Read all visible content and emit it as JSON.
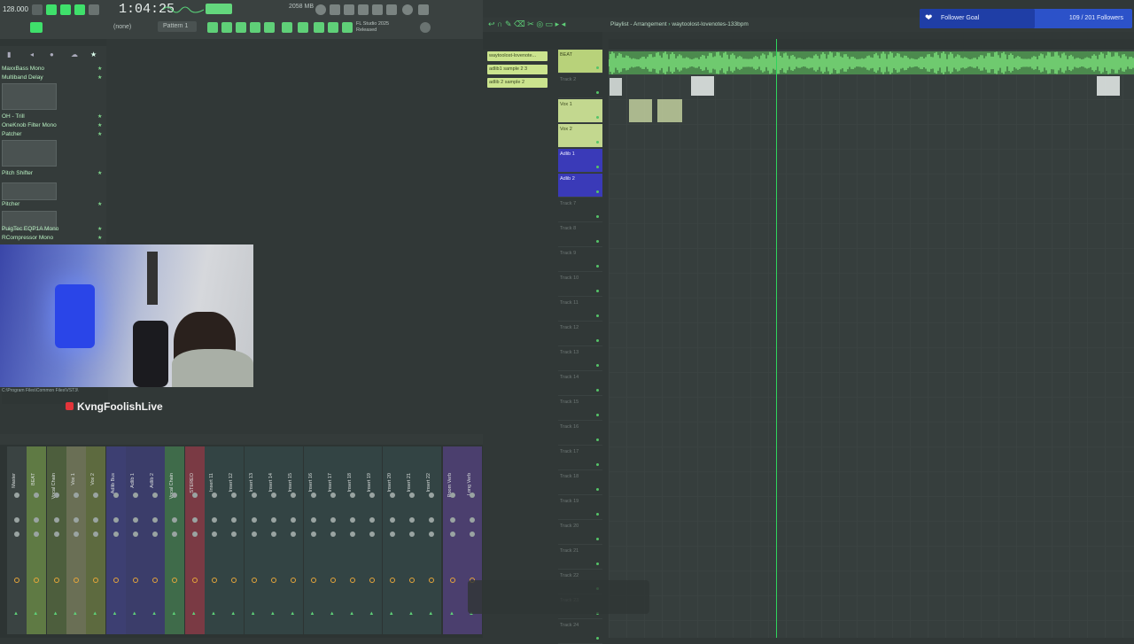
{
  "toolbar": {
    "tempo": "128.000",
    "clock": "1:04:25",
    "pattern": "Pattern 1",
    "snap": "(none)",
    "cpu": "2058 MB",
    "version": "FL Studio 2025",
    "hint": "Released"
  },
  "browser": {
    "items": [
      {
        "label": "MaxxBass Mono",
        "starred": true
      },
      {
        "label": "Multiband Delay",
        "starred": true
      },
      {
        "label": "OH - Trill",
        "starred": true
      },
      {
        "label": "OneKnob Filter Mono",
        "starred": true
      },
      {
        "label": "Patcher",
        "starred": true
      },
      {
        "label": "Pitch Shifter",
        "starred": true
      },
      {
        "label": "Pitcher",
        "starred": true
      },
      {
        "label": "PuigTec EQP1A Mono",
        "starred": true
      },
      {
        "label": "RCompressor Mono",
        "starred": true
      }
    ]
  },
  "stream": {
    "name": "KvngFoolishLive",
    "path_text": "C:\\Program Files\\Common Files\\VST3\\",
    "goal_label": "Follower Goal",
    "goal_count": "109 / 201 Followers",
    "goal_progress": 0.54
  },
  "playlist": {
    "title": "Playlist - Arrangement",
    "song": "waytoolost-lovenotes-133bpm",
    "picker_clips": [
      "waytoolost-lovenote...",
      "adlib1 sample 2 3",
      "adlib 2 sample 2"
    ],
    "tracks": [
      {
        "label": "BEAT",
        "color": "#b8d27a"
      },
      {
        "label": "Track 2",
        "color": ""
      },
      {
        "label": "Vox 1",
        "color": "#c3d88f"
      },
      {
        "label": "Vox 2",
        "color": "#c3d88f"
      },
      {
        "label": "Adlib 1",
        "color": "#3a3ab8"
      },
      {
        "label": "Adlib 2",
        "color": "#3a3ab8"
      },
      {
        "label": "Track 7",
        "color": ""
      },
      {
        "label": "Track 8",
        "color": ""
      },
      {
        "label": "Track 9",
        "color": ""
      },
      {
        "label": "Track 10",
        "color": ""
      },
      {
        "label": "Track 11",
        "color": ""
      },
      {
        "label": "Track 12",
        "color": ""
      },
      {
        "label": "Track 13",
        "color": ""
      },
      {
        "label": "Track 14",
        "color": ""
      },
      {
        "label": "Track 15",
        "color": ""
      },
      {
        "label": "Track 16",
        "color": ""
      },
      {
        "label": "Track 17",
        "color": ""
      },
      {
        "label": "Track 18",
        "color": ""
      },
      {
        "label": "Track 19",
        "color": ""
      },
      {
        "label": "Track 20",
        "color": ""
      },
      {
        "label": "Track 21",
        "color": ""
      },
      {
        "label": "Track 22",
        "color": ""
      },
      {
        "label": "Track 23",
        "color": ""
      },
      {
        "label": "Track 24",
        "color": ""
      }
    ]
  },
  "mixer": {
    "channels": [
      {
        "label": "Master",
        "color": "#3a4342"
      },
      {
        "label": "BEAT",
        "color": "#5f7a44"
      },
      {
        "label": "Vocal Chain",
        "color": "#4d5e3d"
      },
      {
        "label": "Vox 1",
        "color": "#6a6f55"
      },
      {
        "label": "Vox 2",
        "color": "#5d6a3f"
      },
      {
        "label": "Adlib Bus",
        "color": "#3d3f72"
      },
      {
        "label": "Adlib 1",
        "color": "#3b3d6a"
      },
      {
        "label": "Adlib 2",
        "color": "#3b3d6a"
      },
      {
        "label": "Vocal Chain",
        "color": "#3f6b4a"
      },
      {
        "label": "STEREO",
        "color": "#7a3a44"
      },
      {
        "label": "Insert 11",
        "color": "#344"
      },
      {
        "label": "Insert 12",
        "color": "#344"
      },
      {
        "label": "Insert 13",
        "color": "#344"
      },
      {
        "label": "Insert 14",
        "color": "#344"
      },
      {
        "label": "Insert 15",
        "color": "#344"
      },
      {
        "label": "Insert 16",
        "color": "#344"
      },
      {
        "label": "Insert 17",
        "color": "#344"
      },
      {
        "label": "Insert 18",
        "color": "#344"
      },
      {
        "label": "Insert 19",
        "color": "#344"
      },
      {
        "label": "Insert 20",
        "color": "#344"
      },
      {
        "label": "Insert 21",
        "color": "#344"
      },
      {
        "label": "Insert 22",
        "color": "#344"
      },
      {
        "label": "Room Verb",
        "color": "#4b3f6e"
      },
      {
        "label": "Long Verb",
        "color": "#4b3f6e"
      }
    ]
  },
  "colors": {
    "accent": "#2fd45c",
    "waveform": "#7be07a"
  }
}
